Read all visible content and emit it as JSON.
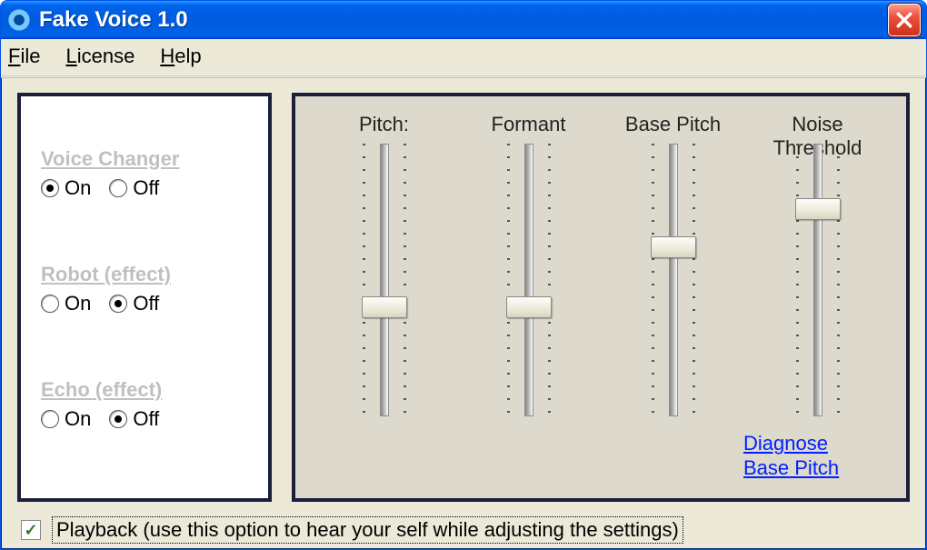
{
  "window": {
    "title": "Fake Voice 1.0"
  },
  "menu": {
    "file": "File",
    "license": "License",
    "help": "Help"
  },
  "effects": {
    "voice_changer": {
      "label": "Voice Changer",
      "value": "On"
    },
    "robot": {
      "label": "Robot (effect)",
      "value": "Off"
    },
    "echo": {
      "label": "Echo (effect)",
      "value": "Off"
    },
    "on_label": "On",
    "off_label": "Off"
  },
  "sliders": {
    "pitch": {
      "label": "Pitch:",
      "value": 40
    },
    "formant": {
      "label": "Formant",
      "value": 40
    },
    "basepitch": {
      "label": "Base Pitch",
      "value": 62
    },
    "noise": {
      "label": "Noise Threshold",
      "value": 76
    }
  },
  "diagnose_link": "Diagnose \nBase Pitch",
  "playback": {
    "checked": true,
    "label": "Playback (use this option to hear your self while adjusting the settings)"
  }
}
